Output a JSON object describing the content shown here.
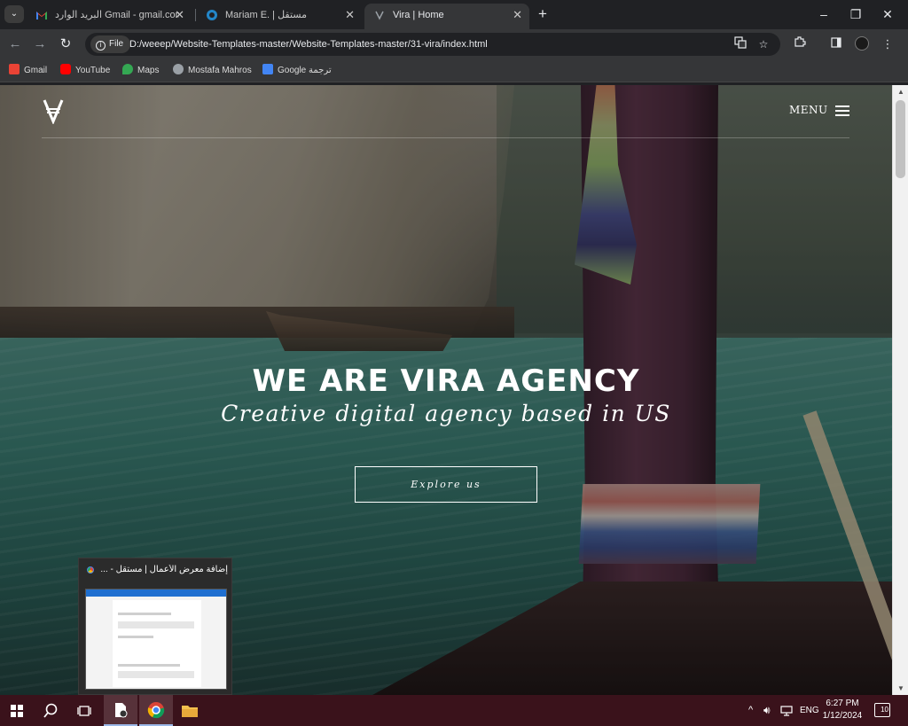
{
  "browser": {
    "tabs": [
      {
        "title": "البريد الوارد Gmail - gmail.com@",
        "close": "✕"
      },
      {
        "title": "Mariam E. | مستقل",
        "close": "✕"
      },
      {
        "title": "Vira | Home",
        "close": "✕"
      }
    ],
    "new_tab": "+",
    "window_controls": {
      "minimize": "–",
      "restore": "❐",
      "close": "✕"
    },
    "toolbar": {
      "back": "←",
      "forward": "→",
      "reload": "↻",
      "chip_label": "File",
      "url": "D:/weeep/Website-Templates-master/Website-Templates-master/31-vira/index.html",
      "menu": "⋮"
    },
    "bookmarks": [
      {
        "label": "Gmail",
        "color": "#ea4335"
      },
      {
        "label": "YouTube",
        "color": "#ff0000"
      },
      {
        "label": "Maps",
        "color": "#34a853"
      },
      {
        "label": "Mostafa Mahros",
        "color": "#9aa0a6"
      },
      {
        "label": "Google ترجمة",
        "color": "#4285f4"
      }
    ]
  },
  "site": {
    "menu_label": "MENU",
    "hero_title": "WE ARE VIRA AGENCY",
    "hero_subtitle": "Creative digital agency based in US",
    "cta_label": "Explore us"
  },
  "preview": {
    "title": "إضافة معرض الأعمال | مستقل - ..."
  },
  "taskbar": {
    "language": "ENG",
    "time": "6:27 PM",
    "date": "1/12/2024",
    "notifications": "10"
  },
  "colors": {
    "tab_strip": "#202124",
    "toolbar": "#353638",
    "taskbar": "#3a121b"
  }
}
